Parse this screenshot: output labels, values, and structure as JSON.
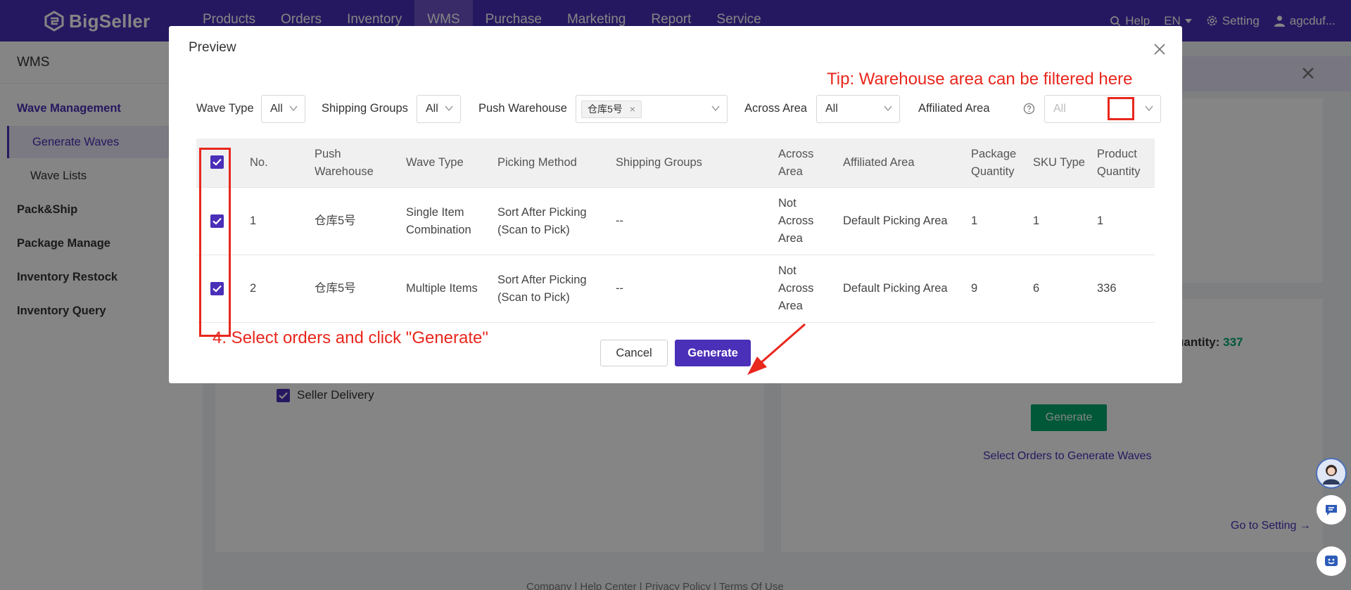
{
  "app": {
    "logo": "BigSeller",
    "nav": [
      "Products",
      "Orders",
      "Inventory",
      "WMS",
      "Purchase",
      "Marketing",
      "Report",
      "Service"
    ],
    "help": "Help",
    "lang": "EN",
    "setting": "Setting",
    "user": "agcduf..."
  },
  "sidebar": {
    "title": "WMS",
    "wave_management": "Wave Management",
    "generate_waves": "Generate Waves",
    "wave_lists": "Wave Lists",
    "pack_ship": "Pack&Ship",
    "package_manage": "Package Manage",
    "inventory_restock": "Inventory Restock",
    "inventory_query": "Inventory Query"
  },
  "background": {
    "quantity_label": "uantity:",
    "quantity_value": "337",
    "seller_delivery": "Seller Delivery",
    "generate_button": "Generate",
    "select_orders_link": "Select Orders to Generate Waves",
    "go_to_setting": "Go to Setting →",
    "footer": "Company  |  Help Center  |  Privacy Policy  |  Terms Of Use"
  },
  "modal": {
    "title": "Preview",
    "tip": "Tip: Warehouse area can be filtered here",
    "filters": {
      "wave_type_label": "Wave Type",
      "wave_type_value": "All",
      "shipping_groups_label": "Shipping Groups",
      "shipping_groups_value": "All",
      "push_warehouse_label": "Push Warehouse",
      "push_warehouse_tag": "仓库5号",
      "across_area_label": "Across Area",
      "across_area_value": "All",
      "affiliated_area_label": "Affiliated Area",
      "affiliated_area_value": "All"
    },
    "columns": {
      "no": "No.",
      "push_warehouse": "Push Warehouse",
      "wave_type": "Wave Type",
      "picking_method": "Picking Method",
      "shipping_groups": "Shipping Groups",
      "across_area": "Across Area",
      "affiliated_area": "Affiliated Area",
      "package_quantity": "Package Quantity",
      "sku_type": "SKU Type",
      "product_quantity": "Product Quantity"
    },
    "rows": [
      {
        "no": "1",
        "push_warehouse": "仓库5号",
        "wave_type": "Single Item Combination",
        "picking_method": "Sort After Picking (Scan to Pick)",
        "shipping_groups": "--",
        "across_area": "Not Across Area",
        "affiliated_area": "Default Picking Area",
        "package_quantity": "1",
        "sku_type": "1",
        "product_quantity": "1"
      },
      {
        "no": "2",
        "push_warehouse": "仓库5号",
        "wave_type": "Multiple Items",
        "picking_method": "Sort After Picking (Scan to Pick)",
        "shipping_groups": "--",
        "across_area": "Not Across Area",
        "affiliated_area": "Default Picking Area",
        "package_quantity": "9",
        "sku_type": "6",
        "product_quantity": "336"
      }
    ],
    "annotation": "4. Select orders and click \"Generate\"",
    "cancel": "Cancel",
    "generate": "Generate"
  },
  "colors": {
    "brand": "#4a2fb8",
    "annotation_red": "#e8271d",
    "success_green": "#00a96e"
  },
  "icons": [
    "bigseller-logo-icon",
    "search-icon",
    "chevron-down-icon",
    "gear-icon",
    "user-icon",
    "close-icon",
    "help-circle-icon",
    "checkbox-checked-icon",
    "red-arrow-icon",
    "avatar",
    "chat-icon",
    "smile-icon"
  ]
}
